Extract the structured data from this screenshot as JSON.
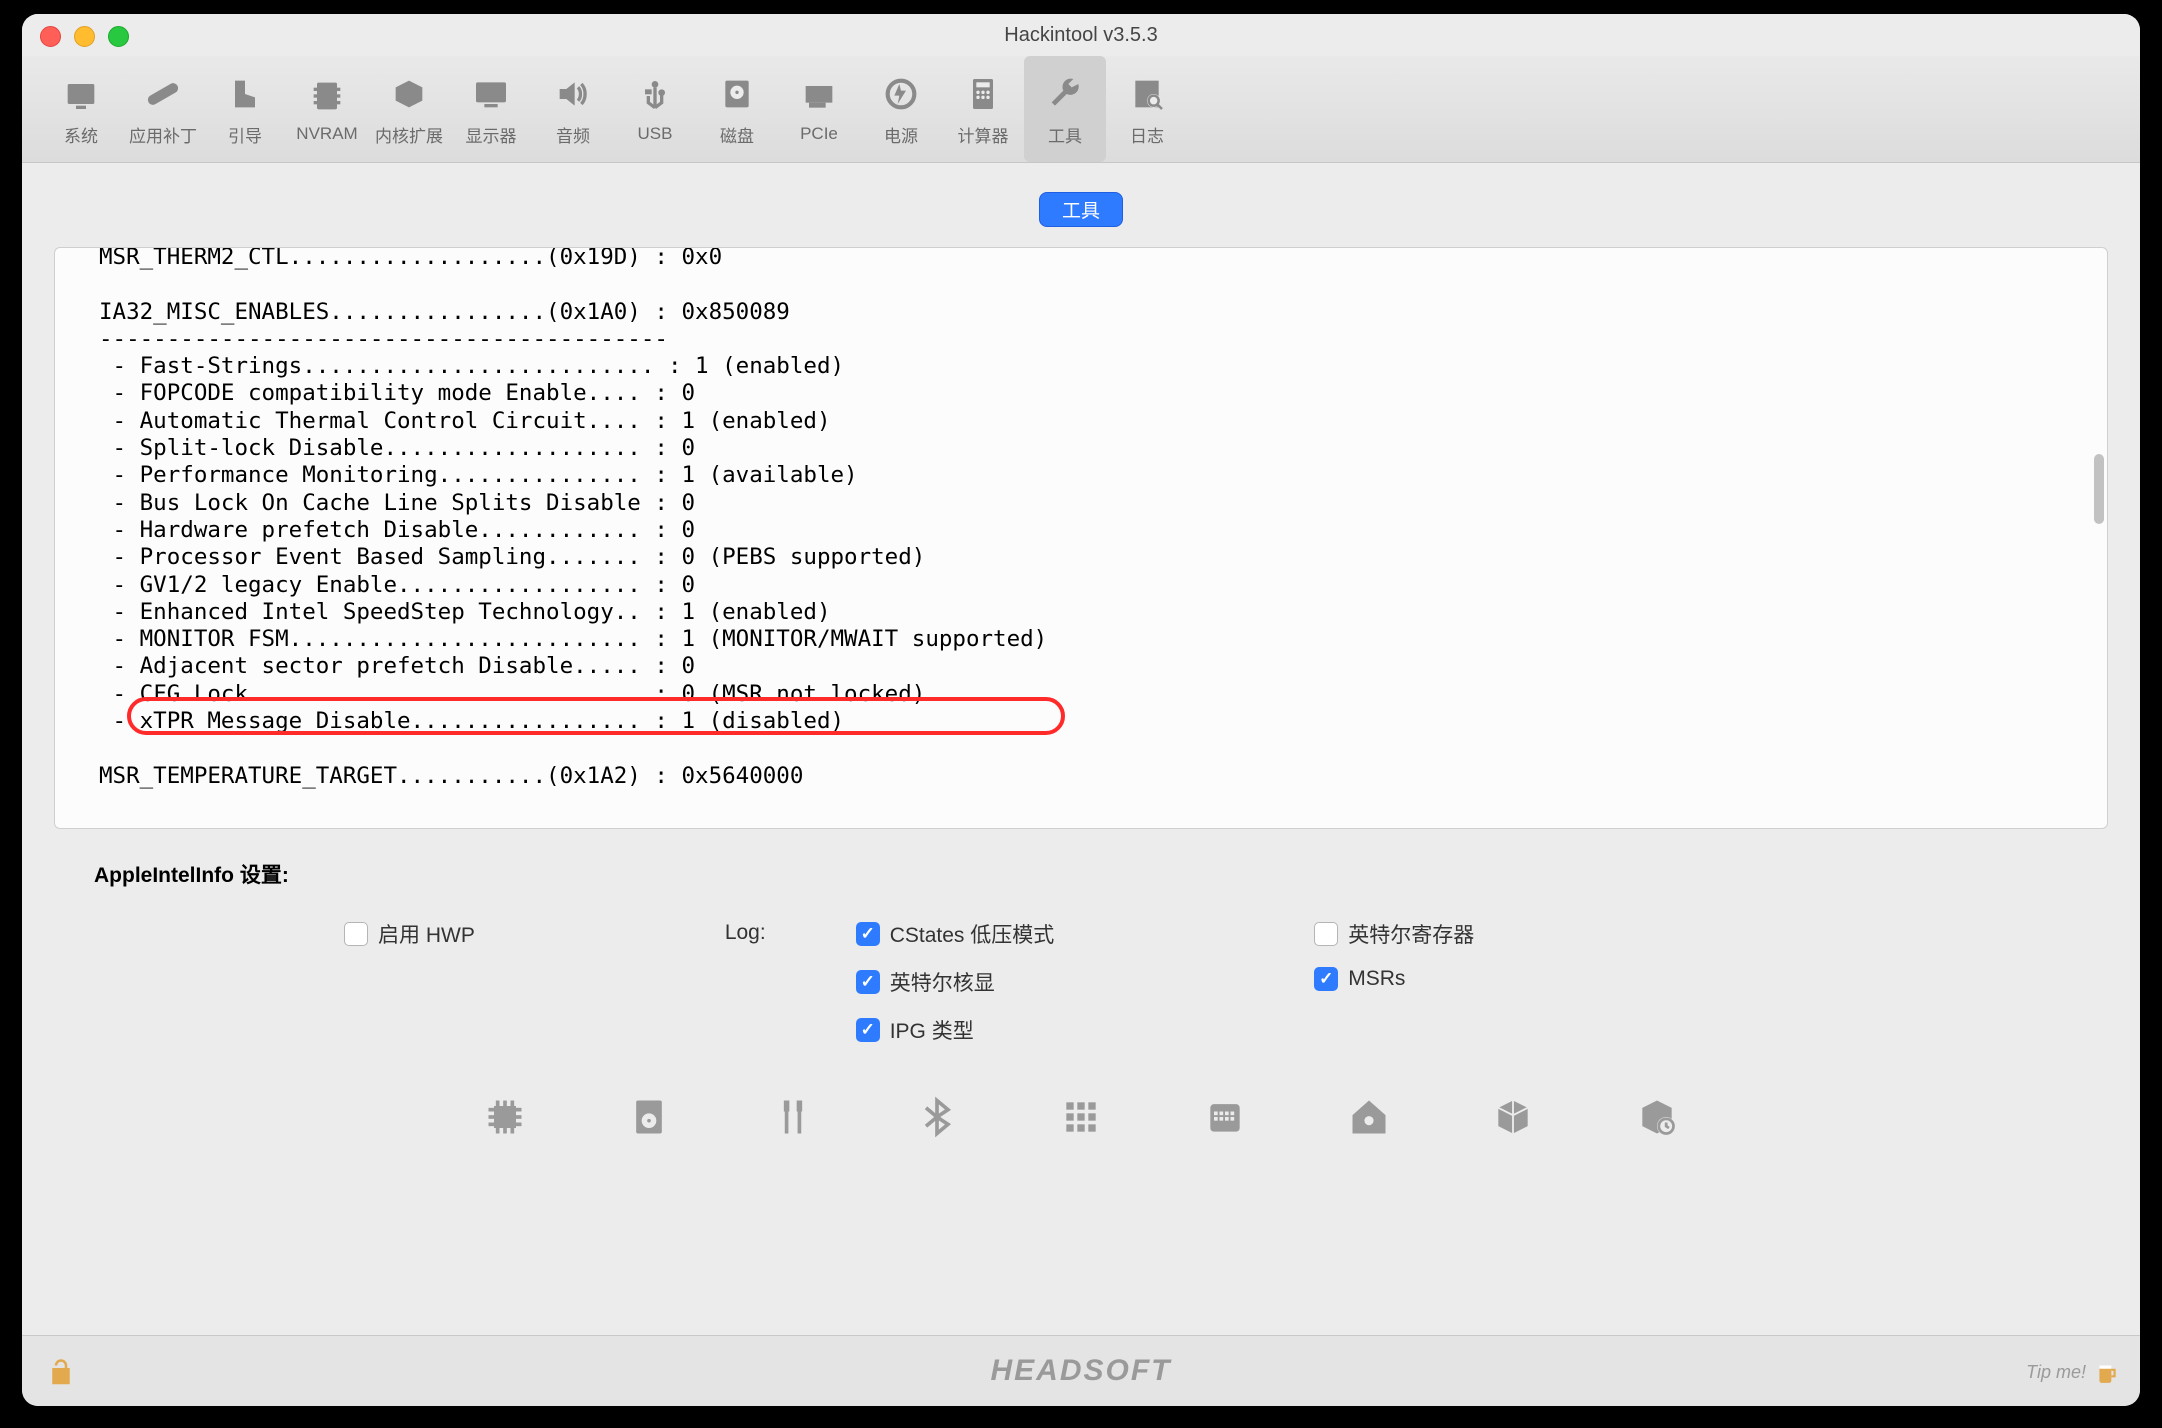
{
  "window": {
    "title": "Hackintool v3.5.3"
  },
  "toolbar": {
    "items": [
      {
        "label": "系统",
        "icon": "monitor"
      },
      {
        "label": "应用补丁",
        "icon": "bandage"
      },
      {
        "label": "引导",
        "icon": "boot"
      },
      {
        "label": "NVRAM",
        "icon": "chip"
      },
      {
        "label": "内核扩展",
        "icon": "module"
      },
      {
        "label": "显示器",
        "icon": "display"
      },
      {
        "label": "音频",
        "icon": "speaker"
      },
      {
        "label": "USB",
        "icon": "usb"
      },
      {
        "label": "磁盘",
        "icon": "disk"
      },
      {
        "label": "PCIe",
        "icon": "pcie"
      },
      {
        "label": "电源",
        "icon": "power"
      },
      {
        "label": "计算器",
        "icon": "calc"
      },
      {
        "label": "工具",
        "icon": "wrench",
        "selected": true
      },
      {
        "label": "日志",
        "icon": "log"
      }
    ]
  },
  "segment": {
    "label": "工具"
  },
  "console": {
    "lines": [
      "MSR_THERM2_CTL...................(0x19D) : 0x0",
      "",
      "IA32_MISC_ENABLES................(0x1A0) : 0x850089",
      "------------------------------------------",
      " - Fast-Strings.......................... : 1 (enabled)",
      " - FOPCODE compatibility mode Enable.... : 0",
      " - Automatic Thermal Control Circuit.... : 1 (enabled)",
      " - Split-lock Disable................... : 0",
      " - Performance Monitoring............... : 1 (available)",
      " - Bus Lock On Cache Line Splits Disable : 0",
      " - Hardware prefetch Disable............ : 0",
      " - Processor Event Based Sampling....... : 0 (PEBS supported)",
      " - GV1/2 legacy Enable.................. : 0",
      " - Enhanced Intel SpeedStep Technology.. : 1 (enabled)",
      " - MONITOR FSM.......................... : 1 (MONITOR/MWAIT supported)",
      " - Adjacent sector prefetch Disable..... : 0",
      " - CFG Lock............................. : 0 (MSR not locked)",
      " - xTPR Message Disable................. : 1 (disabled)",
      "",
      "MSR_TEMPERATURE_TARGET...........(0x1A2) : 0x5640000"
    ]
  },
  "settings": {
    "heading": "AppleIntelInfo 设置:",
    "enable_hwp": "启用 HWP",
    "log_label": "Log:",
    "cstates": "CStates 低压模式",
    "igpu": "英特尔核显",
    "ipg": "IPG 类型",
    "intel_regs": "英特尔寄存器",
    "msrs": "MSRs"
  },
  "checks": {
    "hwp": false,
    "cstates": true,
    "igpu": true,
    "ipg": true,
    "intel_regs": false,
    "msrs": true
  },
  "footer": {
    "logo": "HEADSOFT",
    "tip": "Tip me!"
  },
  "utility_icons": [
    "cpu",
    "disk-dump",
    "cables",
    "bluetooth",
    "grid",
    "calendar",
    "home",
    "cube",
    "cube-time"
  ]
}
